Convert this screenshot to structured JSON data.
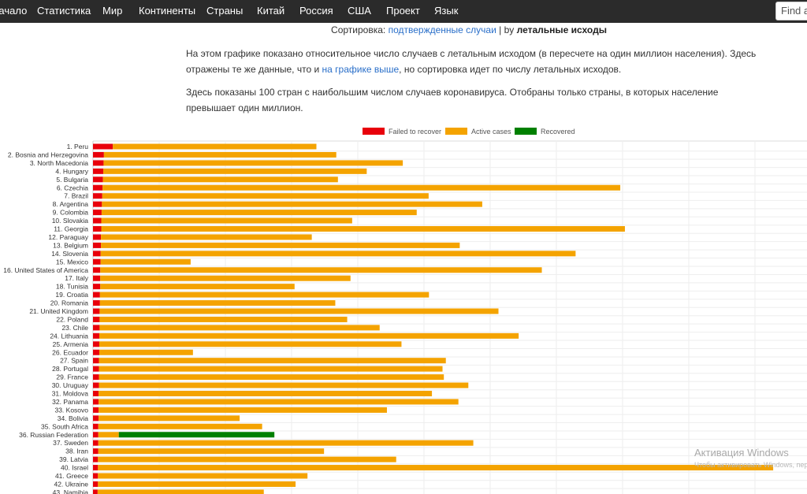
{
  "nav": {
    "items": [
      "Начало",
      "Статистика",
      "Мир",
      "Континенты",
      "Страны",
      "Китай",
      "Россия",
      "США",
      "Проект",
      "Язык"
    ],
    "search_placeholder": "Find a"
  },
  "sort": {
    "label": "Сортировка:",
    "link_confirmed": "подтвержденные случаи",
    "separator": "| by",
    "current": "летальные исходы"
  },
  "intro": {
    "p1_a": "На этом графике показано относительное число случаев с летальным исходом (в пересчете на один миллион населения). Здесь отражены те же данные, что и",
    "p1_link": "на графике выше",
    "p1_b": ", но сортировка идет по числу летальных исходов.",
    "p2": "Здесь показаны 100 стран с наибольшим числом случаев коронавируса. Отобраны только страны, в которых население превышает один миллион."
  },
  "chart_data": {
    "type": "bar",
    "orientation": "horizontal",
    "stacked": true,
    "grid": true,
    "legend_placement": "top",
    "colors": {
      "failed": "#e8000b",
      "active": "#f4a300",
      "recovered": "#008000"
    },
    "series_names": [
      "Failed to recover",
      "Active cases",
      "Recovered"
    ],
    "categories": [
      "1. Peru",
      "2. Bosnia and Herzegovina",
      "3. North Macedonia",
      "4. Hungary",
      "5. Bulgaria",
      "6. Czechia",
      "7. Brazil",
      "8. Argentina",
      "9. Colombia",
      "10. Slovakia",
      "11. Georgia",
      "12. Paraguay",
      "13. Belgium",
      "14. Slovenia",
      "15. Mexico",
      "16. United States of America",
      "17. Italy",
      "18. Tunisia",
      "19. Croatia",
      "20. Romania",
      "21. United Kingdom",
      "22. Poland",
      "23. Chile",
      "24. Lithuania",
      "25. Armenia",
      "26. Ecuador",
      "27. Spain",
      "28. Portugal",
      "29. France",
      "30. Uruguay",
      "31. Moldova",
      "32. Panama",
      "33. Kosovo",
      "34. Bolivia",
      "35. South Africa",
      "36. Russian Federation",
      "37. Sweden",
      "38. Iran",
      "39. Latvia",
      "40. Israel",
      "41. Greece",
      "42. Ukraine",
      "43. Namibia"
    ],
    "failed": [
      6,
      3.3,
      3.2,
      3.1,
      3,
      2.9,
      2.8,
      2.7,
      2.6,
      2.5,
      2.5,
      2.4,
      2.4,
      2.3,
      2.3,
      2.2,
      2.2,
      2.2,
      2.1,
      2.1,
      2,
      2,
      2,
      1.9,
      1.9,
      1.9,
      1.8,
      1.8,
      1.8,
      1.8,
      1.7,
      1.7,
      1.7,
      1.7,
      1.6,
      1.6,
      1.6,
      1.6,
      1.5,
      1.5,
      1.5,
      1.5,
      1.4
    ],
    "active": [
      61.5,
      70.2,
      90.4,
      79.6,
      71,
      156.4,
      98.6,
      114.9,
      95.2,
      75.8,
      158.2,
      63.7,
      108.4,
      143.5,
      27.2,
      133.4,
      75.6,
      58.7,
      99.4,
      71.1,
      120.5,
      74.8,
      84.6,
      126.7,
      91.3,
      28.3,
      104.8,
      103.8,
      104.2,
      111.6,
      100.7,
      108.7,
      87.1,
      42.6,
      49.5,
      6.2,
      113.3,
      68.2,
      90.1,
      204,
      63.3,
      59.7,
      50.2
    ],
    "recovered": [
      0,
      0,
      0,
      0,
      0,
      0,
      0,
      0,
      0,
      0,
      0,
      0,
      0,
      0,
      0,
      0,
      0,
      0,
      0,
      0,
      0,
      0,
      0,
      0,
      0,
      0,
      0,
      0,
      0,
      0,
      0,
      0,
      0,
      0,
      0,
      47,
      0,
      0,
      0,
      0,
      0,
      0,
      0
    ],
    "xlim": [
      0,
      200
    ]
  },
  "watermark": {
    "title": "Активация Windows",
    "subtitle": "Чтобы активировать Windows, перейдите в раздел «Параметры»."
  }
}
